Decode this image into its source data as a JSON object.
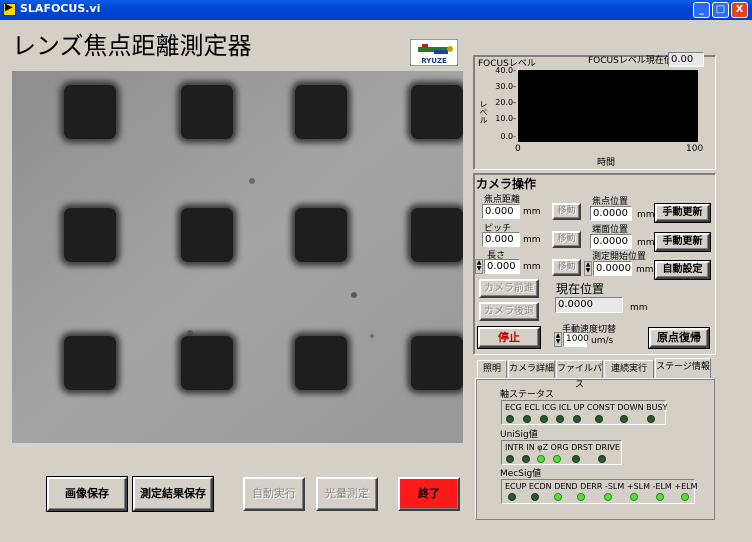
{
  "window": {
    "title": "SLAFOCUS.vi",
    "minimize": "_",
    "maximize": "□",
    "close": "X"
  },
  "app": {
    "heading": "レンズ焦点距離測定器",
    "logo_text": "RYUZE"
  },
  "bottom_buttons": {
    "save_image": "画像保存",
    "save_results": "測定結果保存",
    "auto_run": "自動実行",
    "light_measure": "光量測定",
    "exit": "終了"
  },
  "focus_panel": {
    "title": "FOCUSレベル",
    "current_label": "FOCUSレベル現在値",
    "current_value": "0.00",
    "y_label": "レベル",
    "x_label": "時間",
    "y_ticks": [
      "40.0-",
      "30.0-",
      "20.0-",
      "10.0-",
      "0.0-"
    ],
    "x_ticks": [
      "0",
      "100"
    ]
  },
  "camera_ops": {
    "title": "カメラ操作",
    "focal_distance_label": "焦点距離",
    "focal_distance_value": "0.000",
    "pitch_label": "ピッチ",
    "pitch_value": "0.000",
    "length_label": "長さ",
    "length_value": "0.000",
    "unit_mm": "mm",
    "move_button": "移動",
    "focus_pos_label": "焦点位置",
    "focus_pos_value": "0.0000",
    "face_pos_label": "端面位置",
    "face_pos_value": "0.0000",
    "start_pos_label": "測定開始位置",
    "start_pos_value": "0.0000",
    "manual_update": "手動更新",
    "auto_set": "自動設定",
    "camera_forward": "カメラ前進",
    "camera_back": "カメラ後退",
    "current_pos_label": "現在位置",
    "current_pos_value": "0.0000",
    "stop": "停止",
    "speed_label": "手動速度切替",
    "speed_value": "1000",
    "speed_unit": "um/s",
    "home_return": "原点復帰"
  },
  "tabs": [
    "照明",
    "カメラ詳細",
    "ファイルパス",
    "連続実行",
    "ステージ情報"
  ],
  "stage_info": {
    "axis_status_label": "軸ステータス",
    "axis_status_text": "ECG ECL ICG ICL UP CONST DOWN BUSY",
    "axis_leds": [
      false,
      false,
      false,
      false,
      false,
      false,
      false,
      false
    ],
    "unisig_label": "UniSig値",
    "unisig_text": "INTR IN  φZ ORG DRST DRIVE",
    "unisig_leds": [
      false,
      false,
      true,
      true,
      false,
      false
    ],
    "mecsig_label": "MecSig値",
    "mecsig_text": "ECUP ECDN DEND DERR -SLM +SLM -ELM +ELM",
    "mecsig_leds": [
      false,
      false,
      true,
      true,
      true,
      true,
      true,
      true
    ]
  }
}
